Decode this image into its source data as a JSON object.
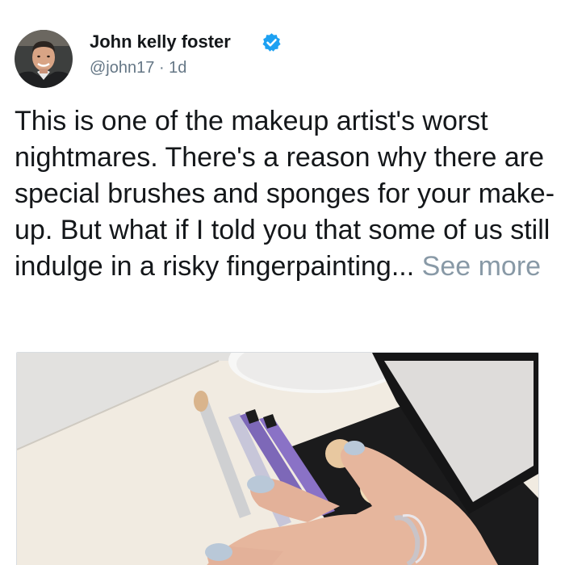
{
  "author": {
    "display_name": "John kelly foster",
    "handle": "@john17",
    "separator": "·",
    "time": "1d",
    "verified": true,
    "verified_icon": "verified-badge-icon",
    "avatar_icon": "user-avatar"
  },
  "post": {
    "text": "This is one of the makeup artist's worst nightmares. There's a reason why there are special brushes and sponges for your make-up. But what if I told you that some of us still indulge in a risky fingerpainting...",
    "see_more_label": "See more"
  },
  "media": {
    "kind": "photo",
    "subject": "makeup-brushes-and-palette"
  },
  "colors": {
    "text": "#14171a",
    "secondary": "#657786",
    "see_more": "#8899a6",
    "verified": "#1da1f2"
  }
}
